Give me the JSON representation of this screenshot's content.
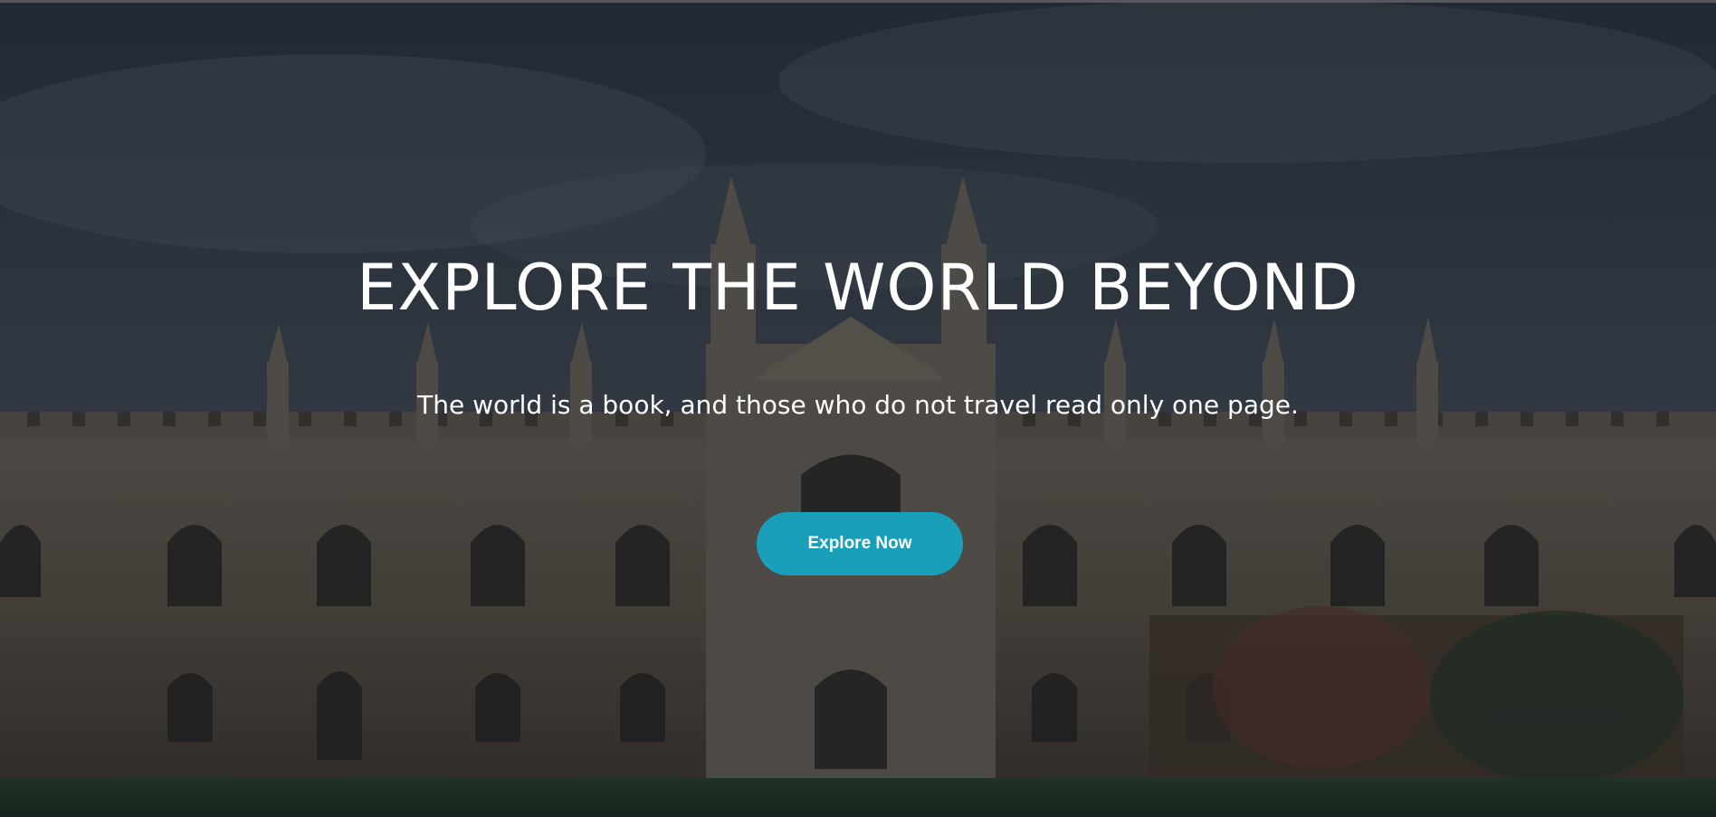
{
  "hero": {
    "title": "EXPLORE THE WORLD BEYOND",
    "subtitle": "The world is a book, and those who do not travel read only one page.",
    "button_label": "Explore Now",
    "accent_color": "#1a9fba",
    "background_description": "photo-of-gothic-college-building"
  }
}
